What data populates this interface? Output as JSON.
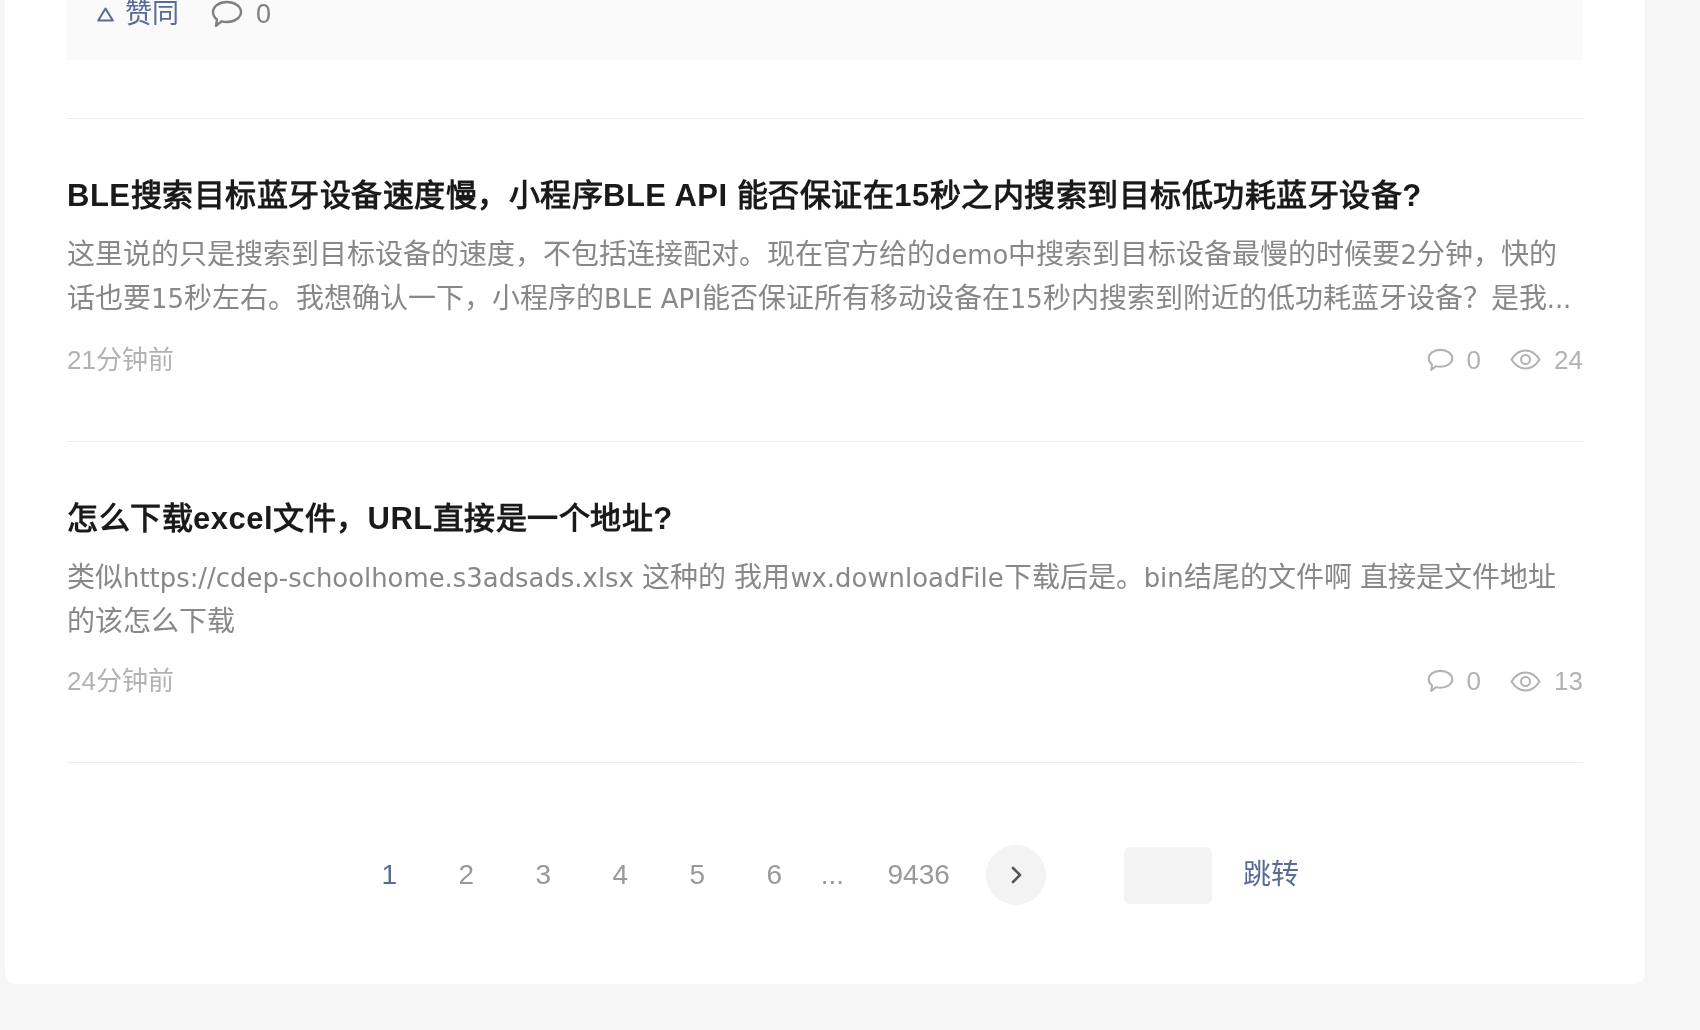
{
  "answer_actions": {
    "upvote_label": "赞同",
    "comment_count": "0"
  },
  "questions": [
    {
      "title": "BLE搜索目标蓝牙设备速度慢，小程序BLE API 能否保证在15秒之内搜索到目标低功耗蓝牙设备?",
      "excerpt": "这里说的只是搜索到目标设备的速度，不包括连接配对。现在官方给的demo中搜索到目标设备最慢的时候要2分钟，快的话也要15秒左右。我想确认一下，小程序的BLE API能否保证所有移动设备在15秒内搜索到附近的低功耗蓝牙设备？是我...",
      "time": "21分钟前",
      "comments": "0",
      "views": "24"
    },
    {
      "title": "怎么下载excel文件，URL直接是一个地址?",
      "excerpt": "类似https://cdep-schoolhome.s3adsads.xlsx 这种的 我用wx.downloadFile下载后是。bin结尾的文件啊 直接是文件地址的该怎么下载",
      "time": "24分钟前",
      "comments": "0",
      "views": "13"
    }
  ],
  "pagination": {
    "items": [
      {
        "kind": "page",
        "label": "1",
        "selected": true
      },
      {
        "kind": "page",
        "label": "2",
        "selected": false
      },
      {
        "kind": "page",
        "label": "3",
        "selected": false
      },
      {
        "kind": "page",
        "label": "4",
        "selected": false
      },
      {
        "kind": "page",
        "label": "5",
        "selected": false
      },
      {
        "kind": "page",
        "label": "6",
        "selected": false
      },
      {
        "kind": "gap",
        "label": "..."
      },
      {
        "kind": "page",
        "label": "9436",
        "selected": false
      }
    ],
    "jump_button": "跳转"
  }
}
